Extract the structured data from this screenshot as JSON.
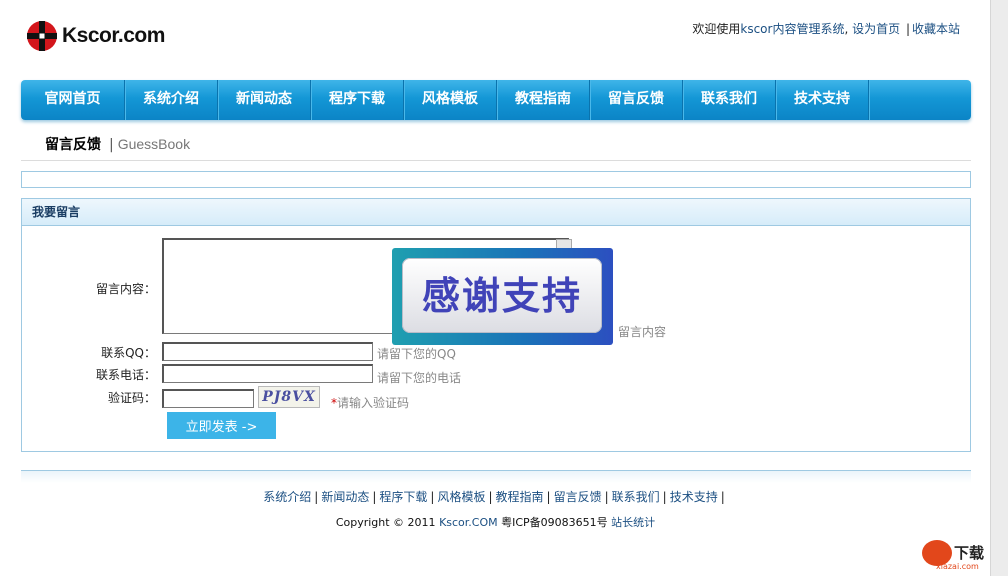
{
  "header": {
    "logo_text": "Kscor.com",
    "welcome_text": "欢迎使用",
    "site_link": "kscor内容管理系统",
    "set_home": "设为首页",
    "bookmark": "收藏本站"
  },
  "nav": {
    "items": [
      {
        "label": "官网首页"
      },
      {
        "label": "系统介绍"
      },
      {
        "label": "新闻动态"
      },
      {
        "label": "程序下载"
      },
      {
        "label": "风格模板"
      },
      {
        "label": "教程指南"
      },
      {
        "label": "留言反馈"
      },
      {
        "label": "联系我们"
      },
      {
        "label": "技术支持"
      }
    ]
  },
  "breadcrumb": {
    "current": "留言反馈",
    "separator": "|",
    "english": "GuessBook"
  },
  "form": {
    "title": "我要留言",
    "content_label": "留言内容：",
    "content_hint": "留言内容",
    "qq_label": "联系QQ：",
    "qq_hint": "请留下您的QQ",
    "phone_label": "联系电话：",
    "phone_hint": "请留下您的电话",
    "captcha_label": "验证码：",
    "captcha_text": "PJ8VX",
    "captcha_star": "*",
    "captcha_hint": "请输入验证码",
    "submit_label": "立即发表 ->"
  },
  "overlay": {
    "text": "感谢支持"
  },
  "footer": {
    "links": [
      {
        "label": "系统介绍"
      },
      {
        "label": "新闻动态"
      },
      {
        "label": "程序下载"
      },
      {
        "label": "风格模板"
      },
      {
        "label": "教程指南"
      },
      {
        "label": "留言反馈"
      },
      {
        "label": "联系我们"
      },
      {
        "label": "技术支持"
      }
    ],
    "copyright_prefix": "Copyright © 2011",
    "copyright_brand": "Kscor.COM",
    "icp": "粤ICP备09083651号",
    "stats_link": "站长统计"
  },
  "watermark": {
    "text": "下载",
    "sub": "xiazai.com"
  },
  "colors": {
    "nav_blue": "#1497d6",
    "link_blue": "#1b4f82",
    "button_blue": "#3cb4e8",
    "panel_border": "#9ec9e2"
  }
}
